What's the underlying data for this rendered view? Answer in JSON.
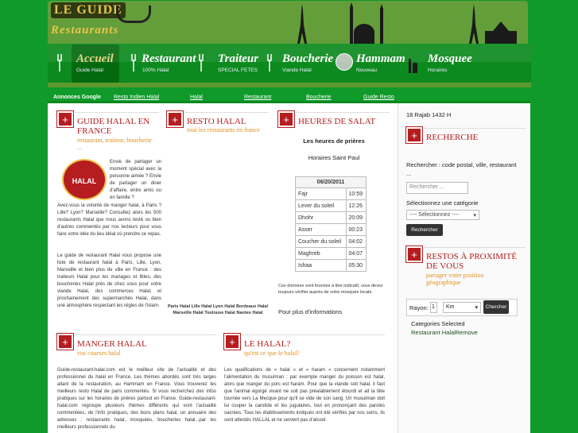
{
  "header": {
    "logo_line1": "LE GUIDE",
    "logo_line2": "Restaurants"
  },
  "nav": [
    {
      "title": "Accueil",
      "sub": "Guide Halal",
      "active": true
    },
    {
      "title": "Restaurant",
      "sub": "100% Halal"
    },
    {
      "title": "Traiteur",
      "sub": "SPECIAL FETES"
    },
    {
      "title": "Boucherie",
      "sub": "Viande Halal"
    },
    {
      "title": "Hammam",
      "sub": "Nouveau"
    },
    {
      "title": "Mosquee",
      "sub": "Horaires"
    }
  ],
  "ads": {
    "label": "Annonces Google",
    "links": [
      "Resto Indien Halal",
      "Halal",
      "Restaurant",
      "Boucherie",
      "Guide Resto"
    ]
  },
  "date_hijri": "18 Rajab 1432 H",
  "guide": {
    "title1": "GUIDE HALAL EN",
    "title2": "FRANCE",
    "sub": "restaurant, traiteur, boucherie ...",
    "logo": "HALAL",
    "p1": "Envie de partager un moment spécial avec la personne aimée ? Envie de partager un diner d'affaire, entre amis ou en famille ?",
    "p2": "Avez-vous la volonté de manger halal, à Paris ? Lille? Lyon? Marseille? Consultez alors les 500 restaurants Halal que nous avons testé ou bien d'autres commentés par nos lecteurs pour vous faire votre idée du lieu idéal où prendre ce repas.",
    "p3": "Le guide de restaurant Halal vous propose une liste de restaurant halal à Paris, Lille, Lyon, Marseille et bien plus de ville en France : des traiteurs Halal pour les mariages et fêtes, des boucheries Halal près de chez vous pour votre viande Halal, des commerces Halal, et prochainement des supermarchés Halal, dans une atmosphère respectant les règles de l'islam."
  },
  "resto": {
    "title": "RESTO HALAL",
    "sub": "tour les restaurants en france",
    "links": "Paris Halal Lille Halal Lyon Halal Bordeaux Halal Marseille Halal Toulouse Halal Nantes Halal"
  },
  "salat": {
    "title": "HEURES DE SALAT",
    "heading": "Les heures de prières",
    "place": "Horaires Saint Paul",
    "date": "06/20/2011",
    "rows": [
      {
        "name": "Fajr",
        "time": "10:59"
      },
      {
        "name": "Lever du soleil",
        "time": "12:26"
      },
      {
        "name": "Dhohr",
        "time": "20:09"
      },
      {
        "name": "Asser",
        "time": "00:23"
      },
      {
        "name": "Coucher du soleil",
        "time": "04:02"
      },
      {
        "name": "Maghreb",
        "time": "04:07"
      },
      {
        "name": "Ishaa",
        "time": "05:30"
      }
    ],
    "note": "Ces données sont fournies à titre indicatif, vous devez toujours vérifier auprès de votre mosquée locale.",
    "more": "Pour plus d'informations"
  },
  "manger": {
    "title": "MANGER HALAL",
    "sub": "vos courses halal",
    "p": "Guide-restaurant-halal.com est le meilleur site de l'actualité et des professionnel du halal en France. Les thèmes abordés sont très larges allant de la restauration, au Hammam en France. Vous trouverez les meilleurs resto Halal de paris commentés. Si vous recherchez des infos pratiques sur les horaires de prières partout en France. Guide-restaurant-halal.com regroupe plusieurs thèmes différents qui vont l'actualité commentées, de l'info pratiques, des bons plans halal, un annuaire des adresses : restaurants halal, mosquées, boucheries halal...par les meilleurs professionnels du"
  },
  "lehalal": {
    "title": "LE HALAL?",
    "sub": "qu'est ce que le halal?",
    "p": "Les qualifications de « halal » et « haram » concernent notamment l'alimentation du musulman : par exemple manger du poisson est halal, alors que manger du porc est haram. Pour que la viande soit halal, il faut que l'animal égorgé vivant ne soit pas préalablement étourdi et ait la tête tournée vers La Mecque pour qu'il se vide de son sang. Un musulman doit lui couper la carotide et les jugulaires, tout en prononçant des paroles sacrées. Tous les établissements indiqués ont été vérifiés par nos soins, ils sont attestés HALLAL et ne servent pas d'alcool."
  },
  "search": {
    "title": "RECHERCHE",
    "label": "Rechercher : code postal, ville, restaurant ...",
    "placeholder": "Rechercher ...",
    "cat_label": "Sélectionnez une catégorie",
    "cat_value": "---- Sélectionnez ----",
    "button": "Rechercher"
  },
  "proximity": {
    "title1": "RESTOS À PROXIMITÉ",
    "title2": "DE VOUS",
    "sub": "partager votre position géographique",
    "radius_label": "Rayon:",
    "radius_value": "1",
    "unit": "Km",
    "button": "Chercher",
    "cat_selected": "Categories Selected",
    "cat_item": "Restaurant HalalRemove"
  }
}
